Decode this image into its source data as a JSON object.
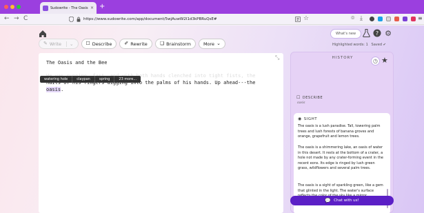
{
  "browser": {
    "tab_title": "Sudowrite - The Oasis and the",
    "tab_close": "×",
    "new_tab": "+",
    "url": "https://www.sudowrite.com/app/document/5wjAuwW2I1d3kPBRuQsE#",
    "nav": {
      "back": "←",
      "forward": "→",
      "reload": "C"
    }
  },
  "toolbar": {
    "write_label": "Write",
    "describe_label": "Describe",
    "rewrite_label": "Rewrite",
    "brainstorm_label": "Brainstorm",
    "more_label": "More"
  },
  "header": {
    "whats_new_label": "What's new",
    "highlighted_words": "Highlighted words: 1",
    "saved_status": "Saved ✔"
  },
  "editor": {
    "title": "The Oasis and the Bee",
    "line1": "He was running, fast, and with both hands clenched into tight fists, the",
    "line2": "nails of his fingers digging into the palms of his hands. Up ahead---the",
    "highlight_word": "oasis",
    "highlight_after": "."
  },
  "suggestions": {
    "chips": [
      "watering hole",
      "claypan",
      "spring",
      "23 more..."
    ]
  },
  "history": {
    "title": "HISTORY",
    "describe_label": "DESCRIBE",
    "describe_subject": "oasis",
    "sight_label": "SIGHT",
    "paragraphs": [
      "The oasis is a lush paradise. Tall, towering palm trees and lush forests of banana groves and orange, grapefruit and lemon trees.",
      "The oasis is a shimmering lake, an oasis of water in this desert. It rests at the bottom of a crater, a hole not made by any crater-forming event in the recent eons. Its edge is ringed by lush green grass, wildflowers and several palm trees.",
      "The oasis is a sight of sparkling green, like a gem that glinted in the light. The water's surface reflects the color of the sky like a mirror."
    ]
  },
  "chat": {
    "label": "Chat with us!"
  },
  "colors": {
    "accent": "#5b1fc6",
    "titlebar": "#9b3fdf",
    "history_bg": "#e6d2f6"
  }
}
